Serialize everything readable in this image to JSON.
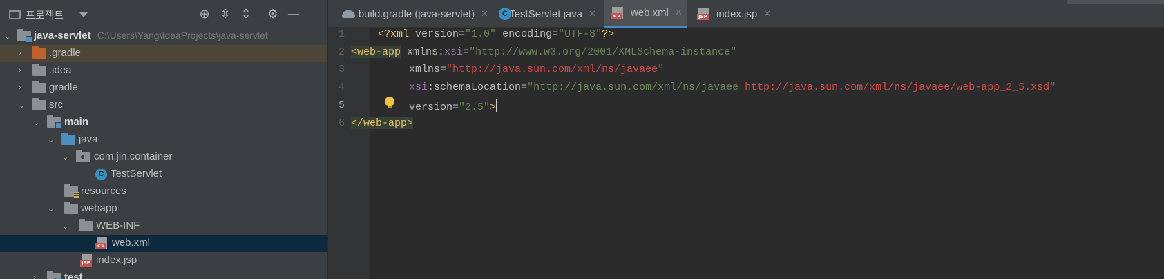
{
  "project_panel": {
    "title": "프로젝트",
    "tree": [
      {
        "label": "java-servlet",
        "path": "C:\\Users\\Yang\\IdeaProjects\\java-servlet"
      },
      {
        "label": ".gradle"
      },
      {
        "label": ".idea"
      },
      {
        "label": "gradle"
      },
      {
        "label": "src"
      },
      {
        "label": "main"
      },
      {
        "label": "java"
      },
      {
        "label": "com.jin.container"
      },
      {
        "label": "TestServlet"
      },
      {
        "label": "resources"
      },
      {
        "label": "webapp"
      },
      {
        "label": "WEB-INF"
      },
      {
        "label": "web.xml"
      },
      {
        "label": "index.jsp"
      },
      {
        "label": "test"
      }
    ],
    "icons": {
      "locate": "crosshair-icon",
      "expand_all": "expand-all-icon",
      "collapse_all": "collapse-all-icon",
      "settings": "gear-icon",
      "hide": "minimize-icon"
    }
  },
  "tabs": [
    {
      "label": "build.gradle (java-servlet)",
      "icon": "gradle-icon",
      "active": false
    },
    {
      "label": "TestServlet.java",
      "icon": "java-class-icon",
      "active": false
    },
    {
      "label": "web.xml",
      "icon": "xml-file-icon",
      "active": true
    },
    {
      "label": "index.jsp",
      "icon": "jsp-file-icon",
      "active": false
    }
  ],
  "editor": {
    "line_numbers": [
      "1",
      "2",
      "3",
      "4",
      "5",
      "6"
    ],
    "current_line": "5",
    "code": {
      "l1_prolog_open": "<?xml ",
      "l1_attr1": "version",
      "l1_val1": "\"1.0\"",
      "l1_attr2": " encoding",
      "l1_val2": "\"UTF-8\"",
      "l1_prolog_close": "?>",
      "l2_tag": "<web-app",
      "l2_attr": " xmlns:",
      "l2_ns": "xsi",
      "l2_val": "\"http://www.w3.org/2001/XMLSchema-instance\"",
      "l3_attr": "xmlns",
      "l3_val": "\"http://java.sun.com/xml/ns/javaee\"",
      "l4_ns": "xsi",
      "l4_attr": ":schemaLocation",
      "l4_val_q": "\"",
      "l4_val1": "http://java.sun.com/xml/ns/javaee",
      "l4_val2": "http://java.sun.com/xml/ns/javaee/web-app_2_5.xsd",
      "l4_val_end": "\"",
      "l5_attr": "version",
      "l5_val": "\"2.5\"",
      "l5_close": ">",
      "l6_tag": "</web-app>"
    }
  },
  "colors": {
    "panel_bg": "#3c3f41",
    "editor_bg": "#2b2b2b",
    "selection": "#0d293e",
    "active_tab_underline": "#4a88c7"
  }
}
